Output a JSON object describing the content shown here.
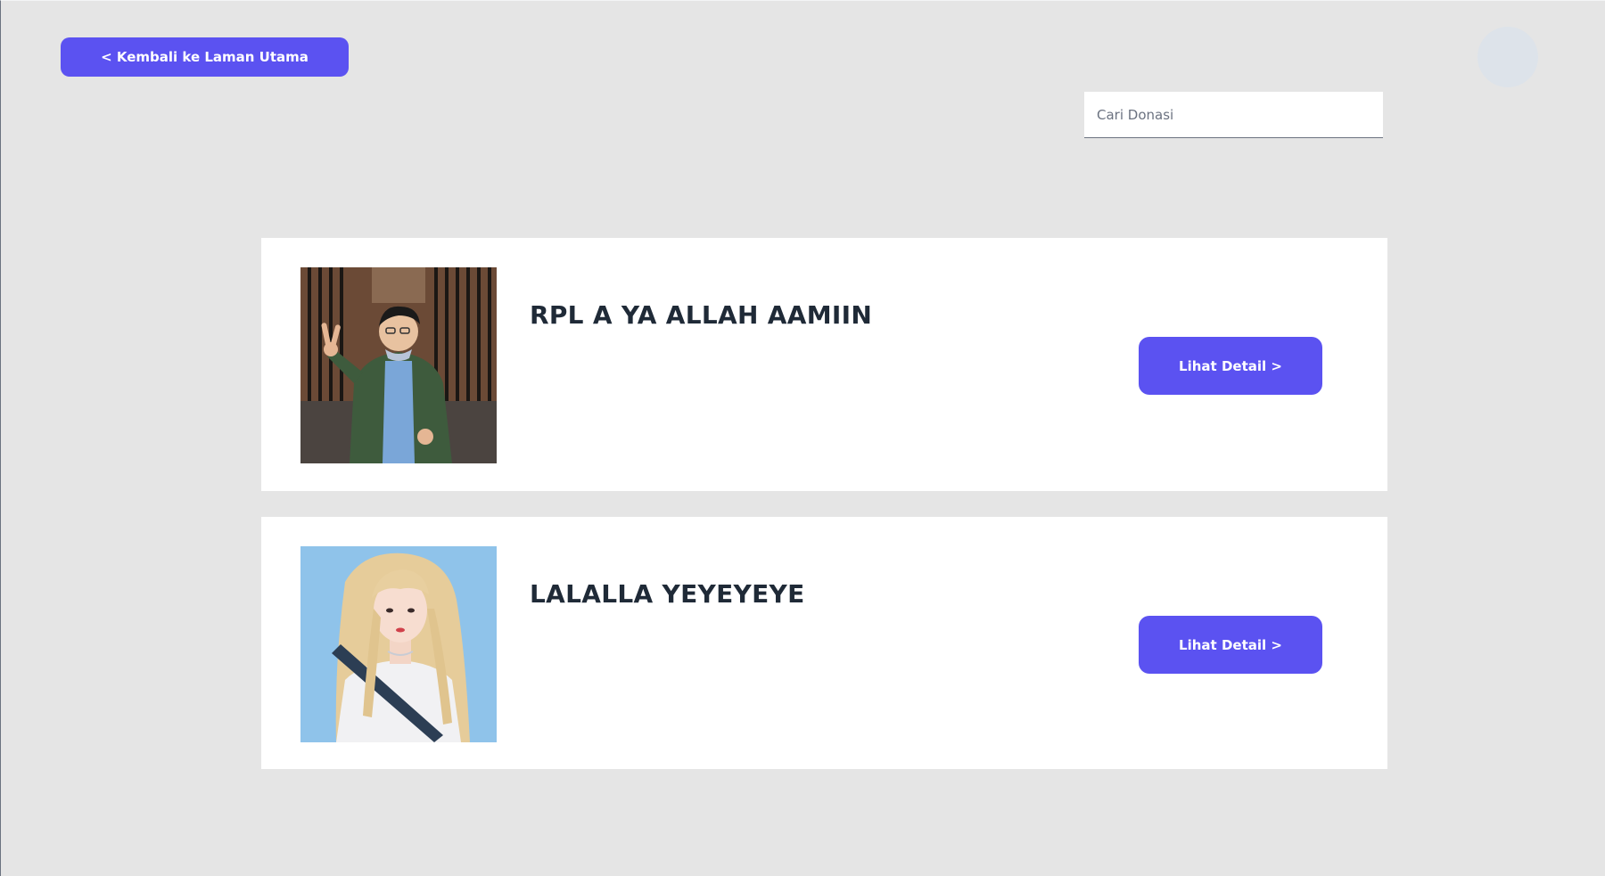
{
  "nav": {
    "back_label": "< Kembali ke Laman Utama"
  },
  "search": {
    "placeholder": "Cari Donasi",
    "value": ""
  },
  "donations": [
    {
      "title": "RPL A YA ALLAH AAMIIN",
      "button_label": "Lihat Detail >",
      "image": "photo of person in green jacket making peace sign"
    },
    {
      "title": "LALALLA YEYEYEYE",
      "button_label": "Lihat Detail >",
      "image": "photo of person with long blonde hair on light blue background"
    }
  ],
  "colors": {
    "accent": "#5b52f1",
    "background": "#e5e5e5",
    "card": "#ffffff",
    "title": "#1f2a37"
  }
}
